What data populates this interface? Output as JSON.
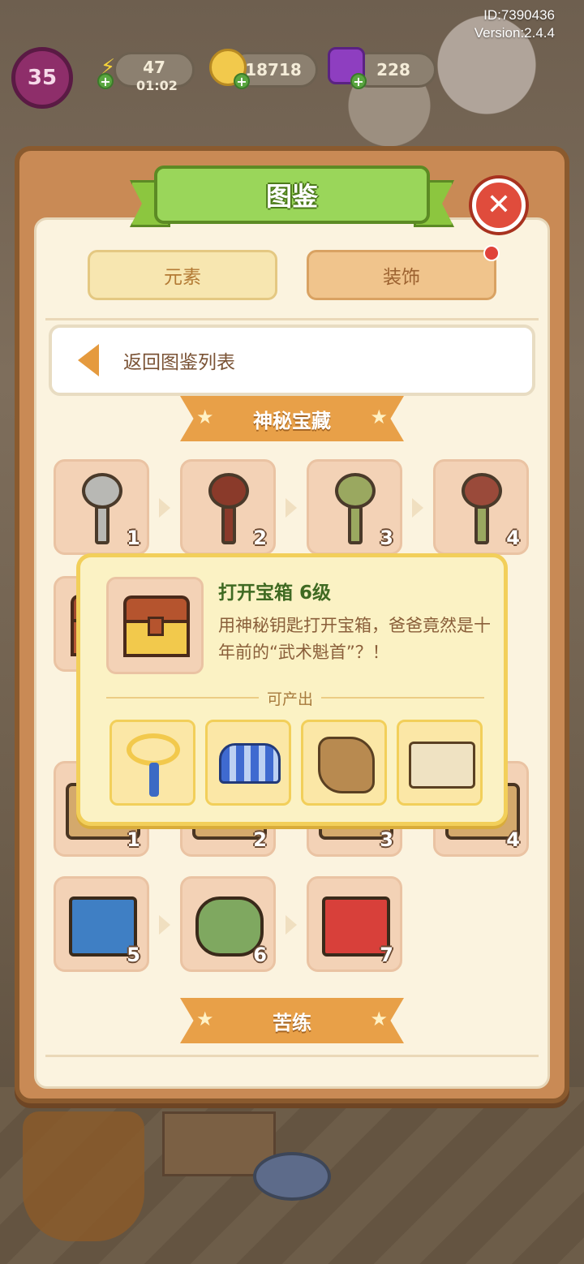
{
  "hud": {
    "id_text": "ID:7390436",
    "version_text": "Version:2.4.4",
    "level": "35",
    "energy": "47",
    "energy_timer": "01:02",
    "coins": "18718",
    "gems": "228"
  },
  "dialog": {
    "title": "图鉴",
    "tabs": [
      {
        "label": "元素",
        "selected": false
      },
      {
        "label": "装饰",
        "selected": true
      }
    ],
    "back_label": "返回图鉴列表"
  },
  "sections": [
    {
      "title": "神秘宝藏",
      "items": [
        {
          "level": "1",
          "icon": "silver-key-icon"
        },
        {
          "level": "2",
          "icon": "bronze-key-icon"
        },
        {
          "level": "3",
          "icon": "jade-key-icon"
        },
        {
          "level": "4",
          "icon": "key-ring-icon"
        },
        {
          "level": "",
          "icon": "treasure-chest-icon"
        }
      ]
    },
    {
      "title": "",
      "items": [
        {
          "level": "1",
          "icon": "scroll-icon"
        },
        {
          "level": "2",
          "icon": "scroll-icon"
        },
        {
          "level": "3",
          "icon": "scroll-icon"
        },
        {
          "level": "4",
          "icon": "scroll-icon"
        },
        {
          "level": "5",
          "icon": "blue-book-icon"
        },
        {
          "level": "6",
          "icon": "green-scrolls-icon"
        },
        {
          "level": "7",
          "icon": "red-book-icon"
        }
      ]
    },
    {
      "title": "苦练"
    }
  ],
  "tooltip": {
    "name": "打开宝箱 6级",
    "description": "用神秘钥匙打开宝箱，爸爸竟然是十年前的“武术魁首”？！",
    "produce_label": "可产出",
    "outputs": [
      "training-wheel-icon",
      "training-ladder-icon",
      "wooden-dummy-icon",
      "martial-scroll-icon"
    ]
  },
  "colors": {
    "panel": "#c98a55",
    "title_green": "#9ad65a",
    "section_orange": "#e8a048",
    "tooltip_bg": "#fbf2c4",
    "close_red": "#e04c3c"
  }
}
